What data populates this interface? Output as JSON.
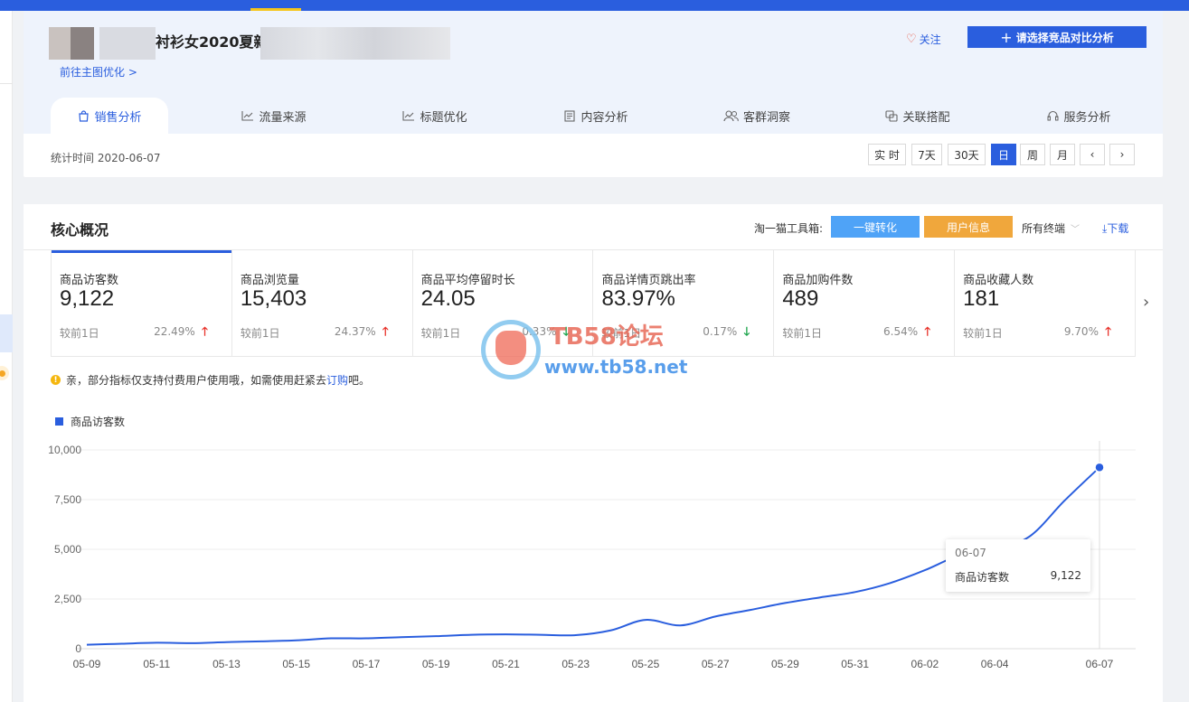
{
  "product": {
    "title": "衬衫女2020夏新",
    "main_img_link": "前往主图优化 >",
    "follow_label": "关注",
    "compare_label": "请选择竞品对比分析"
  },
  "tabs": [
    {
      "label": "销售分析",
      "icon": "shopping-bag-icon",
      "active": true
    },
    {
      "label": "流量来源",
      "icon": "line-chart-icon",
      "active": false
    },
    {
      "label": "标题优化",
      "icon": "line-chart-icon",
      "active": false
    },
    {
      "label": "内容分析",
      "icon": "document-icon",
      "active": false
    },
    {
      "label": "客群洞察",
      "icon": "users-icon",
      "active": false
    },
    {
      "label": "关联搭配",
      "icon": "link-icon",
      "active": false
    },
    {
      "label": "服务分析",
      "icon": "headset-icon",
      "active": false
    }
  ],
  "stat_time": "统计时间 2020-06-07",
  "periods": [
    {
      "label": "实 时",
      "active": false
    },
    {
      "label": "7天",
      "active": false
    },
    {
      "label": "30天",
      "active": false
    },
    {
      "label": "日",
      "active": true
    },
    {
      "label": "周",
      "active": false
    },
    {
      "label": "月",
      "active": false
    }
  ],
  "core": {
    "title": "核心概况",
    "toolbox_label": "淘一猫工具箱:",
    "convert_btn": "一键转化",
    "user_btn": "用户信息",
    "terminal_label": "所有终端",
    "download_label": "下载"
  },
  "metrics": [
    {
      "label": "商品访客数",
      "value": "9,122",
      "cmp": "较前1日",
      "change": "22.49%",
      "dir": "up"
    },
    {
      "label": "商品浏览量",
      "value": "15,403",
      "cmp": "较前1日",
      "change": "24.37%",
      "dir": "up"
    },
    {
      "label": "商品平均停留时长",
      "value": "24.05",
      "cmp": "较前1日",
      "change": "0.33%",
      "dir": "down"
    },
    {
      "label": "商品详情页跳出率",
      "value": "83.97%",
      "cmp": "较前1日",
      "change": "0.17%",
      "dir": "down"
    },
    {
      "label": "商品加购件数",
      "value": "489",
      "cmp": "较前1日",
      "change": "6.54%",
      "dir": "up"
    },
    {
      "label": "商品收藏人数",
      "value": "181",
      "cmp": "较前1日",
      "change": "9.70%",
      "dir": "up"
    }
  ],
  "notice": {
    "text": "亲，部分指标仅支持付费用户使用哦，如需使用赶紧去",
    "link": "订购",
    "suffix": "吧。"
  },
  "colors": {
    "accent": "#2a5ede",
    "up": "#e8332b",
    "down": "#1aa34a",
    "convert": "#4fa3f7",
    "user": "#f0a73c"
  },
  "watermark": {
    "line1": "TB58论坛",
    "line2": "www.tb58.net"
  },
  "tooltip": {
    "date": "06-07",
    "name": "商品访客数",
    "value": "9,122"
  },
  "chart_data": {
    "type": "line",
    "title": "",
    "xlabel": "",
    "ylabel": "",
    "ylim": [
      0,
      10000
    ],
    "y_ticks": [
      0,
      2500,
      5000,
      7500,
      10000
    ],
    "y_tick_labels": [
      "0",
      "2,500",
      "5,000",
      "7,500",
      "10,000"
    ],
    "x_tick_labels": [
      "05-09",
      "05-11",
      "05-13",
      "05-15",
      "05-17",
      "05-19",
      "05-21",
      "05-23",
      "05-25",
      "05-27",
      "05-29",
      "05-31",
      "06-02",
      "06-04",
      "06-07"
    ],
    "legend": "top-left",
    "grid": true,
    "series": [
      {
        "name": "商品访客数",
        "x": [
          "05-09",
          "05-10",
          "05-11",
          "05-12",
          "05-13",
          "05-14",
          "05-15",
          "05-16",
          "05-17",
          "05-18",
          "05-19",
          "05-20",
          "05-21",
          "05-22",
          "05-23",
          "05-24",
          "05-25",
          "05-26",
          "05-27",
          "05-28",
          "05-29",
          "05-30",
          "05-31",
          "06-01",
          "06-02",
          "06-03",
          "06-04",
          "06-05",
          "06-06",
          "06-07"
        ],
        "values": [
          200,
          250,
          300,
          280,
          330,
          370,
          420,
          520,
          520,
          580,
          630,
          700,
          720,
          700,
          680,
          920,
          1450,
          1170,
          1620,
          1950,
          2300,
          2580,
          2850,
          3300,
          3950,
          4700,
          5000,
          5650,
          7450,
          9122
        ]
      }
    ]
  }
}
